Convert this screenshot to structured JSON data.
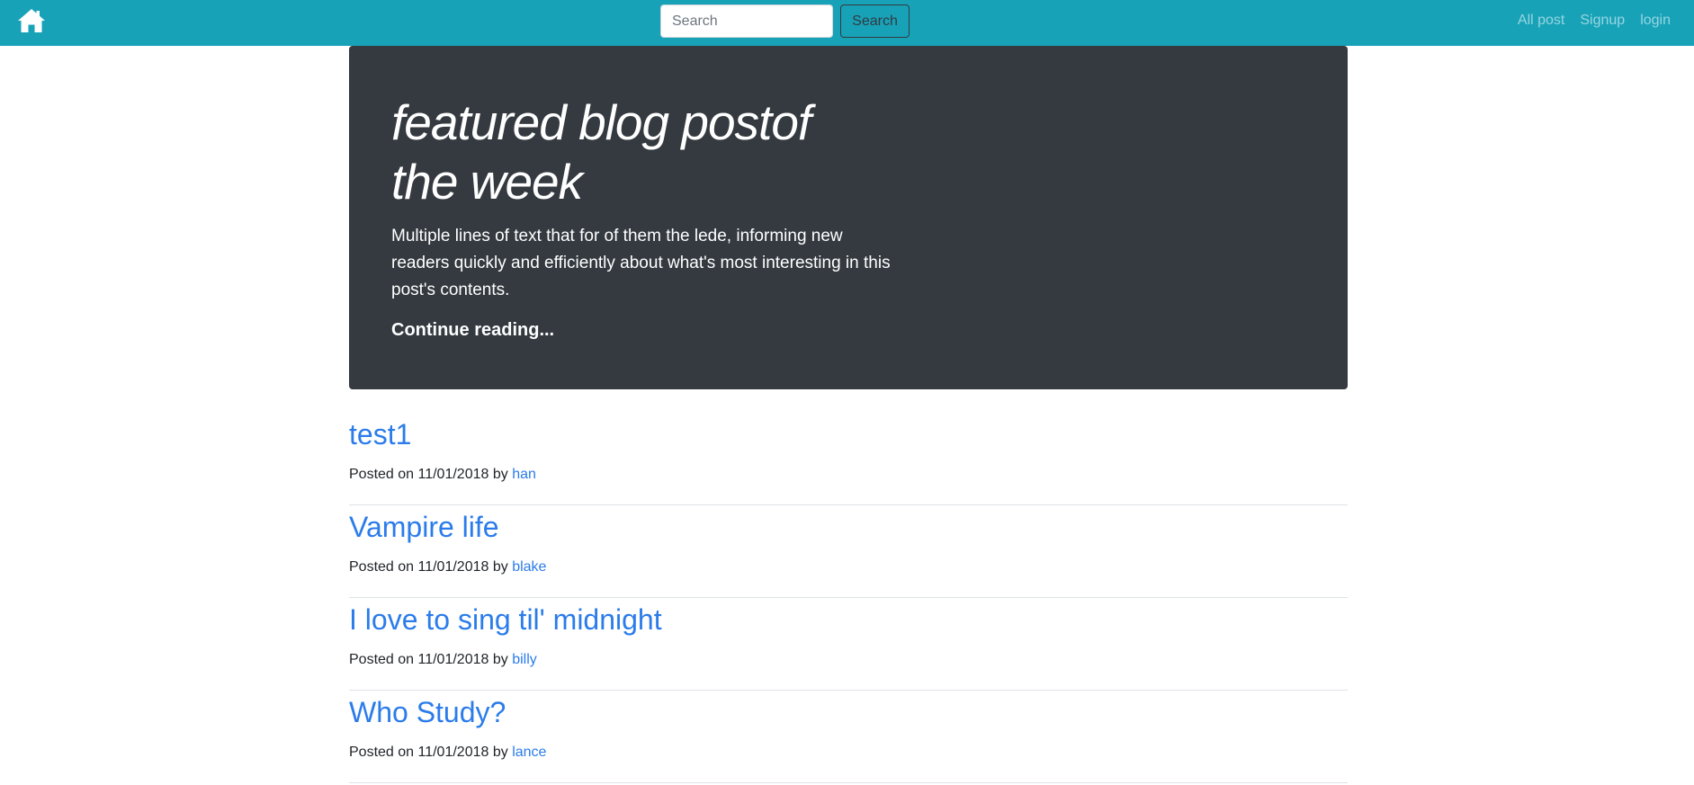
{
  "nav": {
    "home_icon": "home-icon",
    "search_placeholder": "Search",
    "search_button": "Search",
    "links": [
      "All post",
      "Signup",
      "login"
    ]
  },
  "featured": {
    "title": "featured blog postof the week",
    "lede": "Multiple lines of text that for of them the lede, informing new readers quickly and efficiently about what's most interesting in this post's contents.",
    "link": "Continue reading..."
  },
  "posts": [
    {
      "title": "test1",
      "posted_prefix": "Posted on 11/01/2018 by",
      "author": "han"
    },
    {
      "title": "Vampire life",
      "posted_prefix": "Posted on 11/01/2018 by",
      "author": "blake"
    },
    {
      "title": "I love to sing til' midnight",
      "posted_prefix": "Posted on 11/01/2018 by",
      "author": "billy"
    },
    {
      "title": "Who Study?",
      "posted_prefix": "Posted on 11/01/2018 by",
      "author": "lance"
    }
  ],
  "colors": {
    "navbar": "#17a2b8",
    "jumbotron": "#343a40",
    "link": "#2b7cea"
  }
}
